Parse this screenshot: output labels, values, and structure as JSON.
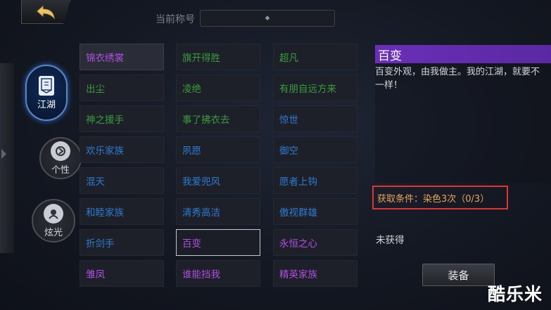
{
  "header": {
    "current_title_label": "当前称号",
    "current_title_value": "◆"
  },
  "categories": [
    {
      "label": "江湖",
      "icon": "banner-icon",
      "active": true
    },
    {
      "label": "个性",
      "icon": "emblem-icon",
      "active": false
    },
    {
      "label": "炫光",
      "icon": "glow-icon",
      "active": false
    }
  ],
  "titles": [
    {
      "label": "锦衣绣裳",
      "color": "#b04fe0"
    },
    {
      "label": "旗开得胜",
      "color": "#3c9a3c"
    },
    {
      "label": "超凡",
      "color": "#3c9a3c"
    },
    {
      "label": "出尘",
      "color": "#3c9a3c"
    },
    {
      "label": "凌绝",
      "color": "#3c9a3c"
    },
    {
      "label": "有朋自远方来",
      "color": "#3c9a3c"
    },
    {
      "label": "神之援手",
      "color": "#3c9a3c"
    },
    {
      "label": "事了拂衣去",
      "color": "#3c9a3c"
    },
    {
      "label": "惊世",
      "color": "#2e7bd0"
    },
    {
      "label": "欢乐家族",
      "color": "#2e7bd0"
    },
    {
      "label": "夙愿",
      "color": "#2e7bd0"
    },
    {
      "label": "御空",
      "color": "#2e7bd0"
    },
    {
      "label": "混天",
      "color": "#2e7bd0"
    },
    {
      "label": "我爱兜风",
      "color": "#2e7bd0"
    },
    {
      "label": "愿者上钩",
      "color": "#2e7bd0"
    },
    {
      "label": "和睦家族",
      "color": "#2e7bd0"
    },
    {
      "label": "清秀高洁",
      "color": "#2e7bd0"
    },
    {
      "label": "傲视群雄",
      "color": "#2e7bd0"
    },
    {
      "label": "折剑手",
      "color": "#2e7bd0"
    },
    {
      "label": "百变",
      "color": "#b04fe0"
    },
    {
      "label": "永恒之心",
      "color": "#b04fe0"
    },
    {
      "label": "雏凤",
      "color": "#b04fe0"
    },
    {
      "label": "谁能挡我",
      "color": "#b04fe0"
    },
    {
      "label": "精英家族",
      "color": "#b04fe0"
    }
  ],
  "detail": {
    "name": "百变",
    "description": "百变外观，由我做主。我的江湖，就要不一样！",
    "condition": "获取条件：染色3次（0/3）",
    "status": "未获得",
    "equip_label": "装备"
  },
  "watermark": "酷乐米",
  "colors": {
    "accent_purple": "#6a2fb8",
    "highlight_red": "#e0342e"
  }
}
